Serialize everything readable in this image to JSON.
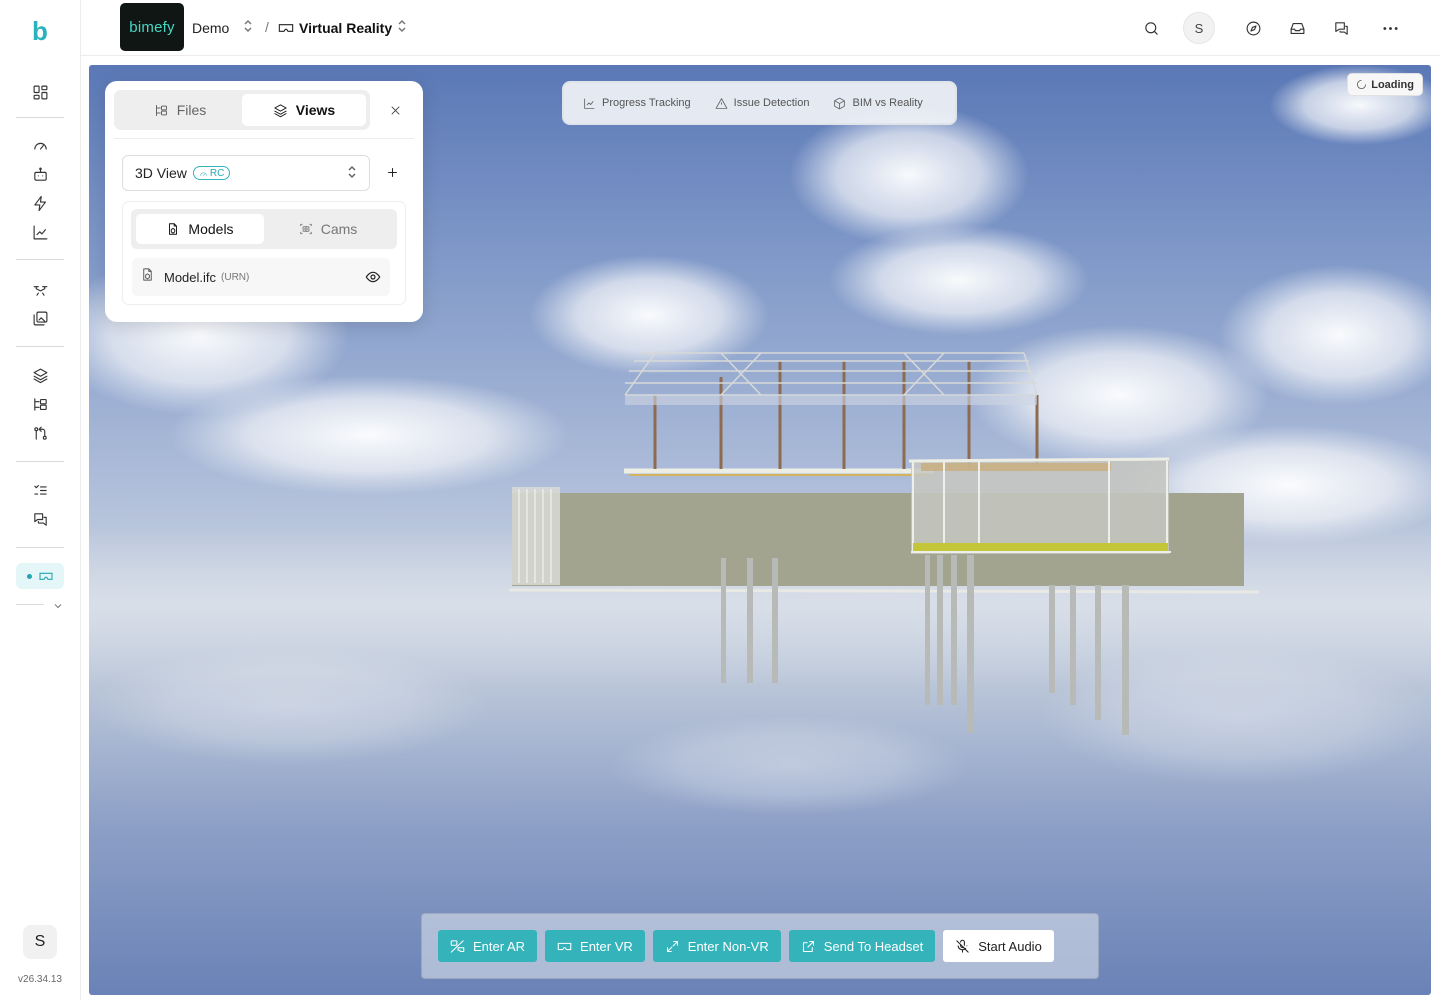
{
  "app": {
    "logo_glyph": "b",
    "version": "v26.34.13",
    "user_initial": "S",
    "accent_color": "#2bb3bd"
  },
  "rail": {
    "icons": [
      "dashboard-icon",
      "gauge-icon",
      "robot-icon",
      "bolt-icon",
      "chart-line-icon",
      "drone-icon",
      "images-icon",
      "layers-icon",
      "tree-icon",
      "git-compare-icon",
      "checklist-icon",
      "messages-icon",
      "vr-headset-icon"
    ],
    "active_item": "vr-headset-icon"
  },
  "header": {
    "brand_logo_text": "bimefy",
    "workspace": "Demo",
    "separator": "/",
    "page": "Virtual Reality",
    "avatar_initial": "S",
    "icons": [
      "search-icon",
      "compass-icon",
      "inbox-icon",
      "chat-icon",
      "more-icon"
    ]
  },
  "viewer": {
    "loading_label": "Loading",
    "modes": [
      {
        "label": "Progress Tracking",
        "icon": "chart-icon"
      },
      {
        "label": "Issue Detection",
        "icon": "warning-icon"
      },
      {
        "label": "BIM vs Reality",
        "icon": "cube-icon"
      }
    ]
  },
  "panel": {
    "tabs": [
      {
        "label": "Files",
        "icon": "tree-icon",
        "active": false
      },
      {
        "label": "Views",
        "icon": "layers-icon",
        "active": true
      }
    ],
    "view_select": {
      "value": "3D View",
      "badge": "RC"
    },
    "subtabs": [
      {
        "label": "Models",
        "icon": "file-model-icon",
        "active": true
      },
      {
        "label": "Cams",
        "icon": "camera-scan-icon",
        "active": false
      }
    ],
    "models": [
      {
        "name": "Model.ifc",
        "tag": "(URN)",
        "visible": true
      }
    ]
  },
  "actions": [
    {
      "label": "Enter AR",
      "icon": "ar-icon",
      "style": "primary"
    },
    {
      "label": "Enter VR",
      "icon": "vr-icon",
      "style": "primary"
    },
    {
      "label": "Enter Non-VR",
      "icon": "expand-icon",
      "style": "primary"
    },
    {
      "label": "Send To Headset",
      "icon": "external-link-icon",
      "style": "primary"
    },
    {
      "label": "Start Audio",
      "icon": "mic-off-icon",
      "style": "secondary"
    }
  ]
}
